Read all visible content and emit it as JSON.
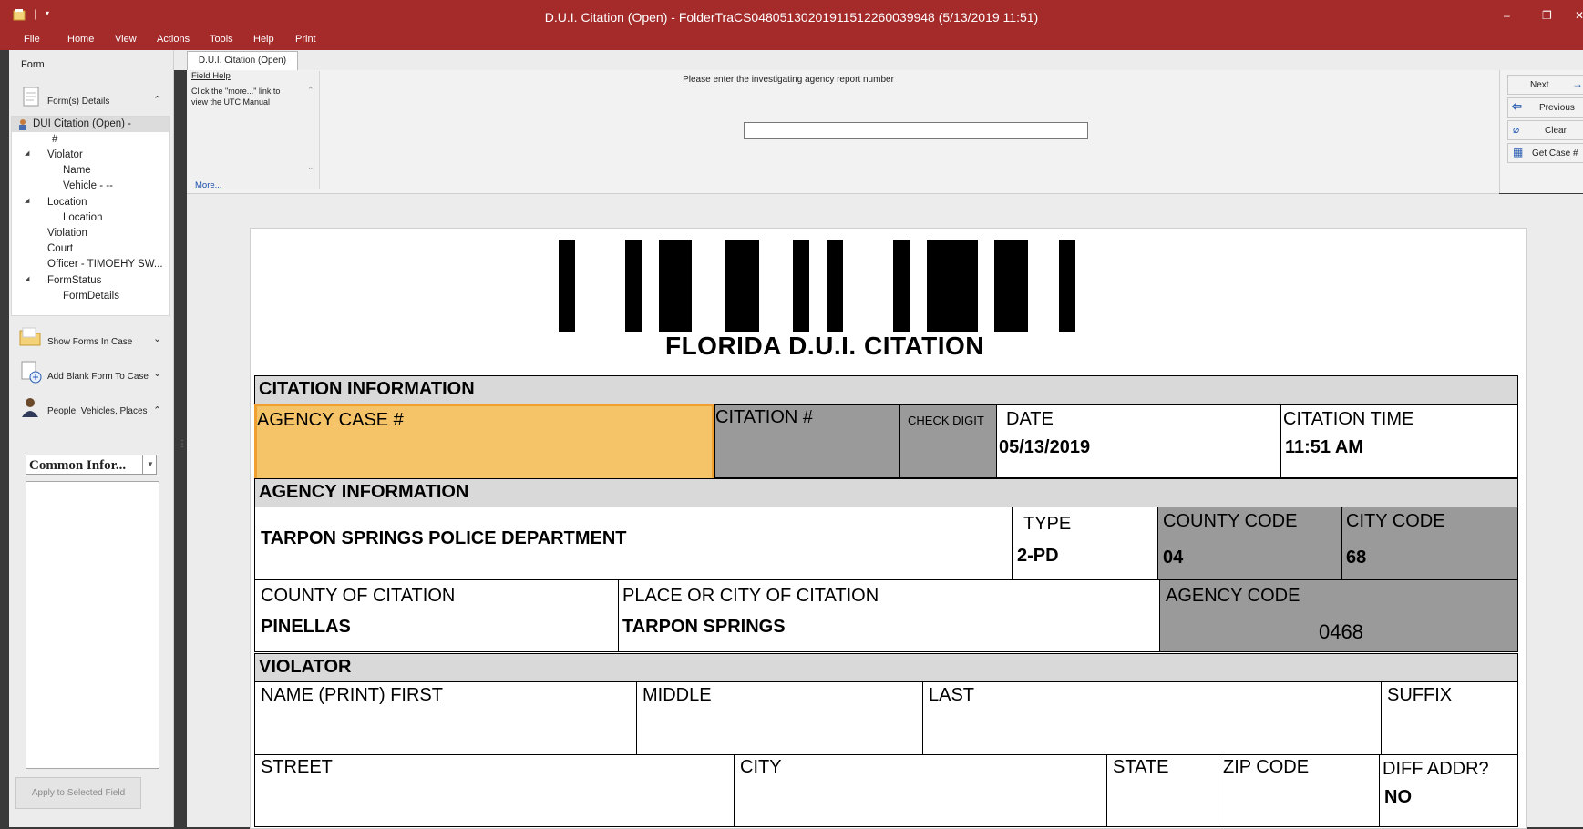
{
  "window": {
    "title": "D.U.I. Citation (Open) - FolderTraCS04805130201911512260039948 (5/13/2019 11:51)",
    "controls": {
      "minimize": "–",
      "restore": "❐",
      "close": "✕"
    }
  },
  "menu": [
    "File",
    "Home",
    "View",
    "Actions",
    "Tools",
    "Help",
    "Print"
  ],
  "left_panel": {
    "header": "Form",
    "forms_details_label": "Form(s) Details",
    "tree": [
      {
        "label": "DUI Citation (Open) -",
        "level": 0,
        "toggle": ""
      },
      {
        "label": "#",
        "level": 1,
        "toggle": ""
      },
      {
        "label": "Violator",
        "level": 1,
        "toggle": "◢"
      },
      {
        "label": "Name",
        "level": 2,
        "toggle": ""
      },
      {
        "label": "Vehicle - --",
        "level": 2,
        "toggle": ""
      },
      {
        "label": "Location",
        "level": 1,
        "toggle": "◢"
      },
      {
        "label": "Location",
        "level": 2,
        "toggle": ""
      },
      {
        "label": "Violation",
        "level": 1,
        "toggle": ""
      },
      {
        "label": "Court",
        "level": 1,
        "toggle": ""
      },
      {
        "label": "Officer - TIMOEHY SW...",
        "level": 1,
        "toggle": ""
      },
      {
        "label": "FormStatus",
        "level": 1,
        "toggle": "◢"
      },
      {
        "label": "FormDetails",
        "level": 2,
        "toggle": ""
      }
    ],
    "sections": [
      {
        "label": "Show Forms In Case",
        "chevron": "⌄"
      },
      {
        "label": "Add Blank Form To Case",
        "chevron": "⌄"
      },
      {
        "label": "People, Vehicles, Places",
        "chevron": "⌃"
      }
    ],
    "common_info_select": "Common Infor...",
    "apply_button": "Apply to Selected Field"
  },
  "tab": {
    "label": "D.U.I. Citation (Open)"
  },
  "help": {
    "title": "Field Help",
    "text_line1": "Click the \"more...\" link to",
    "text_line2": "view the UTC Manual",
    "more_link": "More..."
  },
  "prompt": {
    "text": "Please enter the investigating agency report number",
    "value": ""
  },
  "nav_buttons": [
    {
      "label": "Next",
      "icon": "→"
    },
    {
      "label": "Previous",
      "icon": "⇦"
    },
    {
      "label": "Clear",
      "icon": "⌀"
    },
    {
      "label": "Get Case #",
      "icon": "▦"
    }
  ],
  "form": {
    "title": "FLORIDA D.U.I. CITATION",
    "citation_info": {
      "header": "CITATION INFORMATION",
      "agency_case_label": "AGENCY CASE #",
      "agency_case_value": "",
      "citation_no_label": "CITATION #",
      "check_digit_label": "CHECK DIGIT",
      "date_label": "DATE",
      "date_value": "05/13/2019",
      "time_label": "CITATION TIME",
      "time_value": "11:51 AM"
    },
    "agency_info": {
      "header": "AGENCY INFORMATION",
      "agency_name": "TARPON SPRINGS POLICE DEPARTMENT",
      "type_label": "TYPE",
      "type_value": "2-PD",
      "county_code_label": "COUNTY CODE",
      "county_code_value": "04",
      "city_code_label": "CITY CODE",
      "city_code_value": "68",
      "county_of_citation_label": "COUNTY OF CITATION",
      "county_of_citation_value": "PINELLAS",
      "place_label": "PLACE OR CITY OF CITATION",
      "place_value": "TARPON SPRINGS",
      "agency_code_label": "AGENCY CODE",
      "agency_code_value": "0468"
    },
    "violator": {
      "header": "VIOLATOR",
      "first_label": "NAME (PRINT) FIRST",
      "middle_label": "MIDDLE",
      "last_label": "LAST",
      "suffix_label": "SUFFIX",
      "street_label": "STREET",
      "city_label": "CITY",
      "state_label": "STATE",
      "zip_label": "ZIP CODE",
      "diff_addr_label": "DIFF ADDR?",
      "diff_addr_value": "NO"
    }
  }
}
